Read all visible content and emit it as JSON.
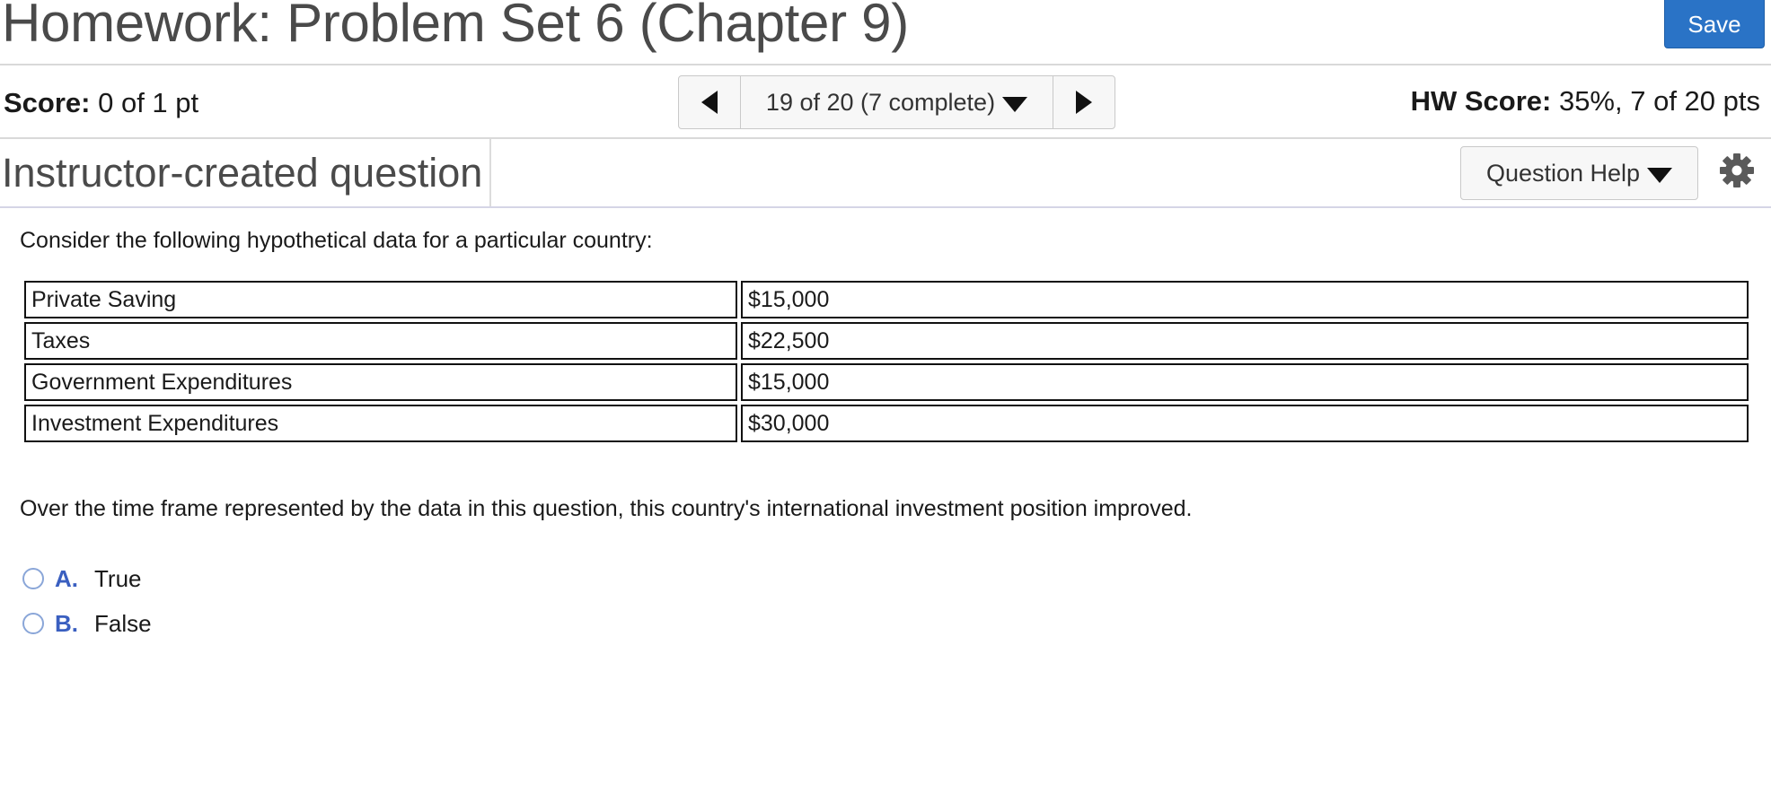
{
  "header": {
    "title": "Homework: Problem Set 6 (Chapter 9)",
    "save_label": "Save"
  },
  "score_bar": {
    "score_label": "Score:",
    "score_value": "0 of 1 pt",
    "navigator": "19 of 20 (7 complete)",
    "hw_score_label": "HW Score:",
    "hw_score_value": "35%, 7 of 20 pts"
  },
  "question_header": {
    "type": "Instructor-created question",
    "help_label": "Question Help"
  },
  "question": {
    "prompt": "Consider the following hypothetical data for a particular country:",
    "table": [
      {
        "label": "Private Saving",
        "value": "$15,000"
      },
      {
        "label": "Taxes",
        "value": "$22,500"
      },
      {
        "label": "Government Expenditures",
        "value": "$15,000"
      },
      {
        "label": "Investment Expenditures",
        "value": "$30,000"
      }
    ],
    "statement": "Over the time frame represented by the data in this question, this country's international investment position improved.",
    "choices": [
      {
        "letter": "A.",
        "text": "True"
      },
      {
        "letter": "B.",
        "text": "False"
      }
    ]
  },
  "icons": {
    "prev": "triangle-left-icon",
    "next": "triangle-right-icon",
    "dropdown": "caret-down-icon",
    "settings": "gear-icon"
  },
  "colors": {
    "save_button": "#2a73c6",
    "choice_letter": "#3a5fc0"
  }
}
